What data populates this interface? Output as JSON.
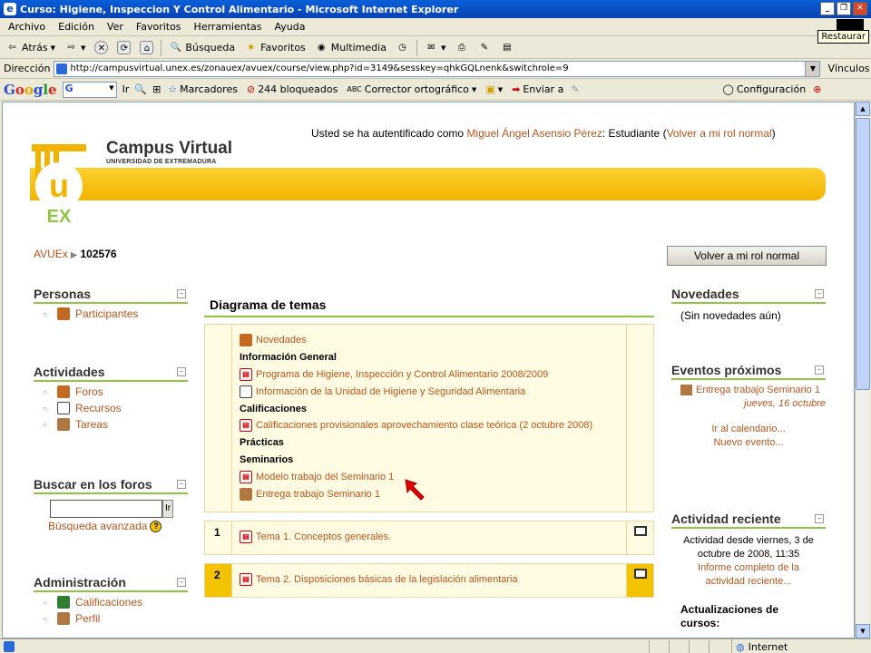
{
  "window": {
    "title": "Curso: Higiene, Inspeccion Y Control Alimentario - Microsoft Internet Explorer",
    "restore_tooltip": "Restaurar"
  },
  "menu": [
    "Archivo",
    "Edición",
    "Ver",
    "Favoritos",
    "Herramientas",
    "Ayuda"
  ],
  "toolbar": {
    "back": "Atrás",
    "search": "Búsqueda",
    "favorites": "Favoritos",
    "multimedia": "Multimedia"
  },
  "address": {
    "label": "Dirección",
    "url": "http://campusvirtual.unex.es/zonauex/avuex/course/view.php?id=3149&sesskey=qhkGQLnenk&switchrole=9",
    "links": "Vínculos"
  },
  "google_bar": {
    "logo": "Google",
    "go": "Ir",
    "bookmarks": "Marcadores",
    "blocked": "244 bloqueados",
    "spellcheck": "Corrector ortográfico",
    "send": "Enviar a",
    "settings": "Configuración"
  },
  "page": {
    "auth_prefix": "Usted se ha autentificado como ",
    "auth_user": "Miguel Ángel Asensio Pérez",
    "auth_role": ": Estudiante (",
    "auth_link": "Volver a mi rol normal",
    "auth_suffix": ")",
    "logo_title": "Campus Virtual",
    "logo_subtitle": "UNIVERSIDAD DE EXTREMADURA",
    "logo_letters": "UEX",
    "breadcrumb_home": "AVUEx",
    "breadcrumb_current": "102576",
    "role_button": "Volver a mi rol normal"
  },
  "left_blocks": {
    "personas": {
      "title": "Personas",
      "items": [
        "Participantes"
      ]
    },
    "actividades": {
      "title": "Actividades",
      "items": [
        "Foros",
        "Recursos",
        "Tareas"
      ]
    },
    "buscar": {
      "title": "Buscar en los foros",
      "go": "Ir",
      "advanced": "Búsqueda avanzada",
      "help": "?"
    },
    "admin": {
      "title": "Administración",
      "items": [
        "Calificaciones",
        "Perfil"
      ]
    }
  },
  "topics": {
    "title": "Diagrama de temas",
    "section0": {
      "novedades": "Novedades",
      "info_label": "Información General",
      "programa": "Programa de Higiene, Inspección y Control Alimentario 2008/2009",
      "info_unidad": "Información de la Unidad de Higiene y Seguridad Alimentaria",
      "calif_label": "Calificaciones",
      "calif_item": "Calificaciones provisionales aprovechamiento clase teórica (2 octubre 2008)",
      "practicas_label": "Prácticas",
      "seminarios_label": "Seminarios",
      "modelo": "Modelo trabajo del Seminario 1",
      "entrega": "Entrega trabajo Seminario 1"
    },
    "sections": [
      {
        "num": "1",
        "title": "Tema 1. Conceptos generales."
      },
      {
        "num": "2",
        "title": "Tema 2. Disposiciones básicas de la legislación alimentaria"
      }
    ]
  },
  "right_blocks": {
    "novedades": {
      "title": "Novedades",
      "text": "(Sin novedades aún)"
    },
    "eventos": {
      "title": "Eventos próximos",
      "event_name": "Entrega trabajo Seminario 1",
      "event_date": "jueves, 16 octubre",
      "calendar": "Ir al calendario...",
      "new_event": "Nuevo evento..."
    },
    "reciente": {
      "title": "Actividad reciente",
      "since": "Actividad desde viernes, 3 de octubre de 2008, 11:35",
      "report": "Informe completo de la actividad reciente...",
      "updates": "Actualizaciones de cursos:"
    }
  },
  "status": {
    "zone": "Internet"
  }
}
